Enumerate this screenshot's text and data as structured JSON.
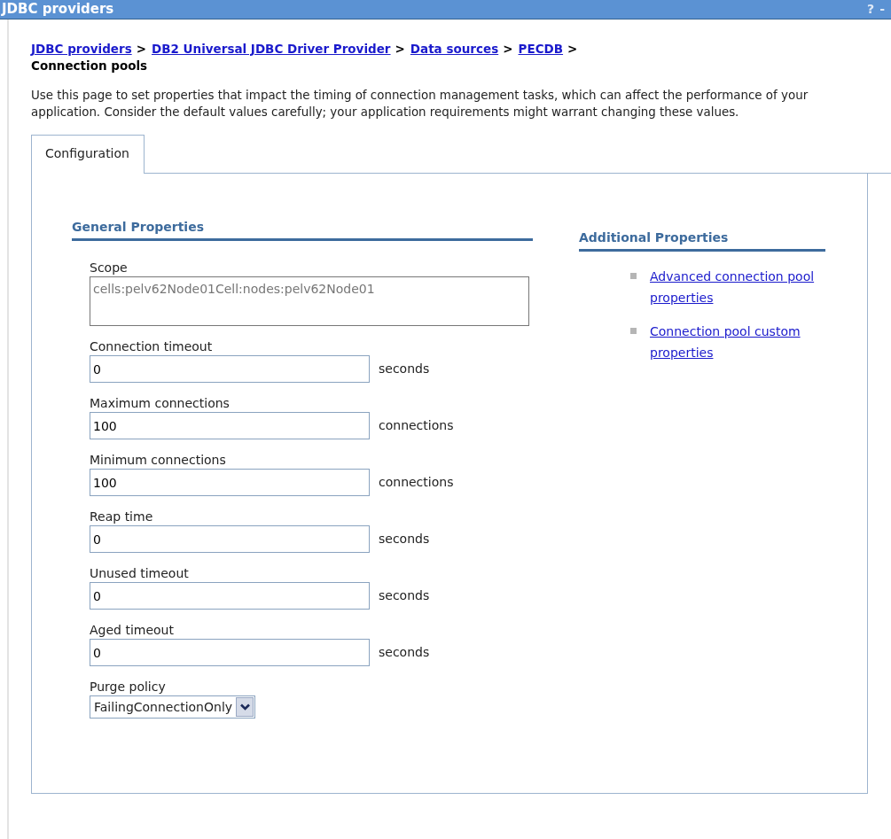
{
  "window": {
    "title": "JDBC providers",
    "controls": [
      "?",
      "-"
    ]
  },
  "breadcrumb": [
    {
      "label": "JDBC providers",
      "kind": "link",
      "separator": ">"
    },
    {
      "label": "DB2 Universal JDBC Driver Provider",
      "kind": "link",
      "separator": ">"
    },
    {
      "label": "Data sources",
      "kind": "link",
      "separator": ">"
    },
    {
      "label": "PECDB",
      "kind": "link",
      "separator": ">"
    },
    {
      "label": "Connection pools",
      "kind": "current"
    }
  ],
  "description": "Use this page to set properties that impact the timing of connection management tasks, which can affect the performance of your application. Consider the default values carefully; your application requirements might warrant changing these values.",
  "tabs": [
    {
      "label": "Configuration",
      "selected": true
    }
  ],
  "general_properties": {
    "title": "General Properties",
    "fields": [
      {
        "kind": "readonly",
        "label": "Scope",
        "value": "cells:pelv62Node01Cell:nodes:pelv62Node01"
      },
      {
        "kind": "text",
        "label": "Connection timeout",
        "value": "0",
        "unit": "seconds"
      },
      {
        "kind": "text",
        "label": "Maximum connections",
        "value": "100",
        "unit": "connections"
      },
      {
        "kind": "text",
        "label": "Minimum connections",
        "value": "100",
        "unit": "connections"
      },
      {
        "kind": "text",
        "label": "Reap time",
        "value": "0",
        "unit": "seconds"
      },
      {
        "kind": "text",
        "label": "Unused timeout",
        "value": "0",
        "unit": "seconds"
      },
      {
        "kind": "text",
        "label": "Aged timeout",
        "value": "0",
        "unit": "seconds"
      },
      {
        "kind": "select",
        "label": "Purge policy",
        "value": "FailingConnectionOnly"
      }
    ]
  },
  "additional_properties": {
    "title": "Additional Properties",
    "links": [
      "Advanced connection pool properties",
      "Connection pool custom properties"
    ]
  }
}
